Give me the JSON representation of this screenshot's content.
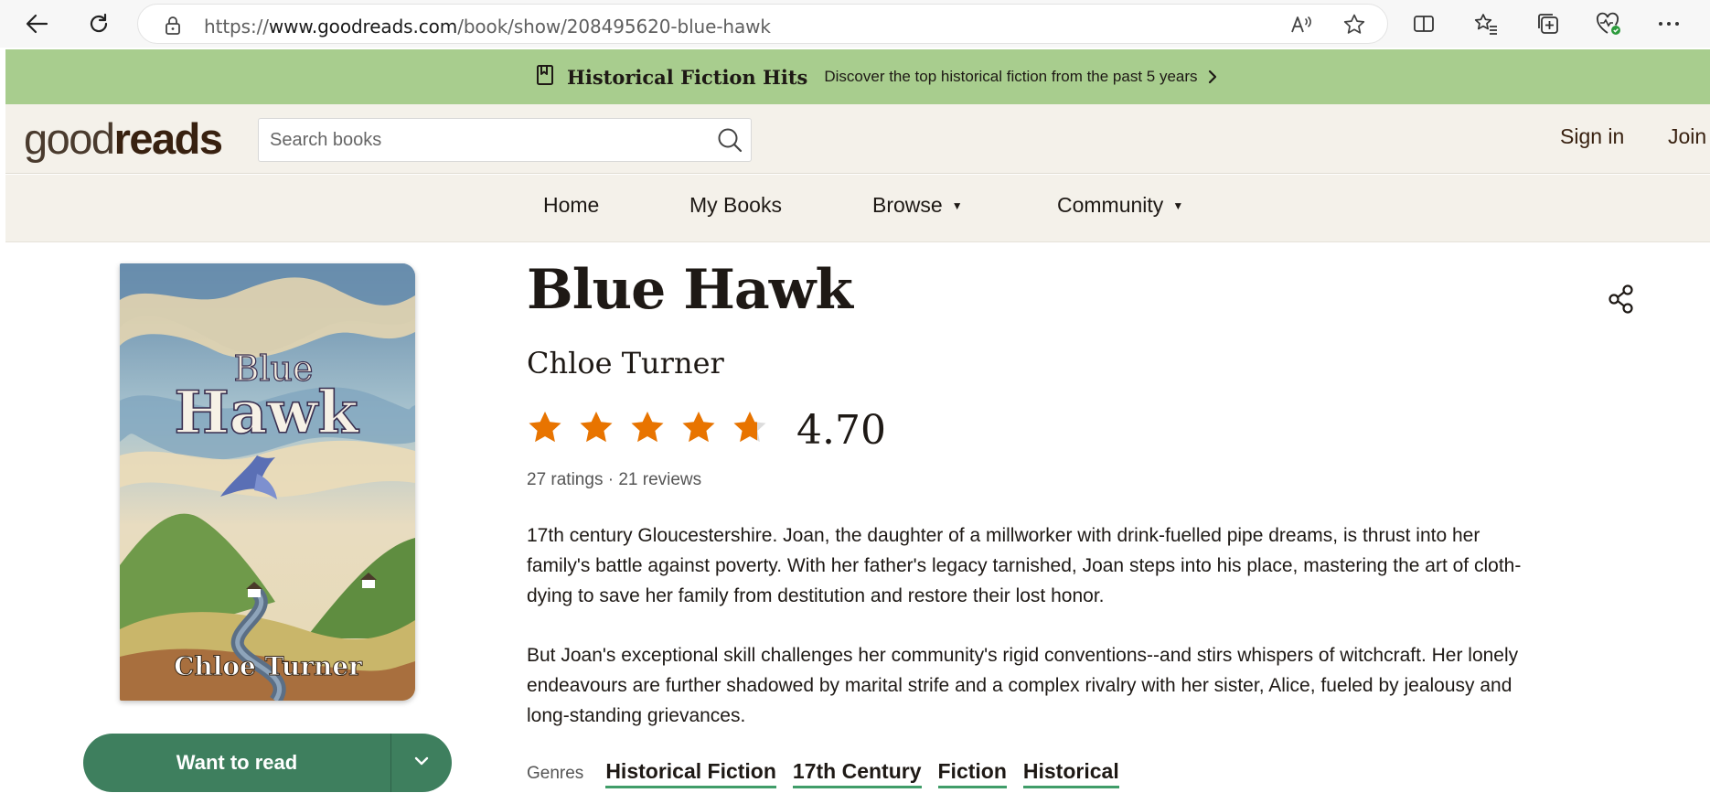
{
  "browser": {
    "url_prefix": "https://",
    "url_domain": "www.goodreads.com",
    "url_path": "/book/show/208495620-blue-hawk"
  },
  "promo": {
    "title": "Historical Fiction Hits",
    "description": "Discover the top historical fiction from the past 5 years"
  },
  "header": {
    "logo_light": "good",
    "logo_bold": "reads",
    "search_placeholder": "Search books",
    "sign_in": "Sign in",
    "join": "Join"
  },
  "nav": {
    "home": "Home",
    "my_books": "My Books",
    "browse": "Browse",
    "community": "Community",
    "caret": "▼"
  },
  "book": {
    "title": "Blue Hawk",
    "author": "Chloe Turner",
    "rating": "4.70",
    "rating_value": 4.7,
    "rating_max": 5,
    "counts": "27 ratings · 21 reviews",
    "cover_title_top": "Blue",
    "cover_title_bottom": "Hawk",
    "cover_author": "Chloe Turner",
    "description_1": "17th century Gloucestershire. Joan, the daughter of a millworker with drink-fuelled pipe dreams, is thrust into her family's battle against poverty. With her father's legacy tarnished, Joan steps into his place, mastering the art of cloth-dying to save her family from destitution and restore their lost honor.",
    "description_2": "But Joan's exceptional skill challenges her community's rigid conventions--and stirs whispers of witchcraft. Her lonely endeavours are further shadowed by marital strife and a complex rivalry with her sister, Alice, fueled by jealousy and long-standing grievances."
  },
  "actions": {
    "want_to_read": "Want to read"
  },
  "genres": {
    "label": "Genres",
    "items": [
      "Historical Fiction",
      "17th Century",
      "Fiction",
      "Historical"
    ]
  },
  "colors": {
    "banner": "#a8cd8e",
    "header_bg": "#f4f1ea",
    "star": "#e87400",
    "button": "#3e7f5e",
    "genre_underline": "#409d69"
  }
}
